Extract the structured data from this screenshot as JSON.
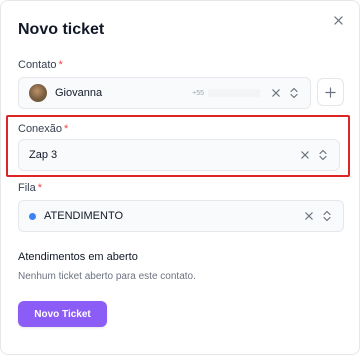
{
  "modal": {
    "title": "Novo ticket",
    "close_icon": "close-icon"
  },
  "contato": {
    "label": "Contato",
    "required_mark": "*",
    "name": "Giovanna",
    "phone": "+55",
    "add_icon": "plus-icon"
  },
  "conexao": {
    "label": "Conexão",
    "required_mark": "*",
    "value": "Zap 3"
  },
  "fila": {
    "label": "Fila",
    "required_mark": "*",
    "value": "ATENDIMENTO",
    "color": "#3b82f6"
  },
  "open_tickets": {
    "title": "Atendimentos em aberto",
    "empty_text": "Nenhum ticket aberto para este contato."
  },
  "actions": {
    "create_label": "Novo Ticket"
  },
  "colors": {
    "accent": "#8b5cf6",
    "highlight": "#dc2626",
    "required": "#ef4444"
  }
}
